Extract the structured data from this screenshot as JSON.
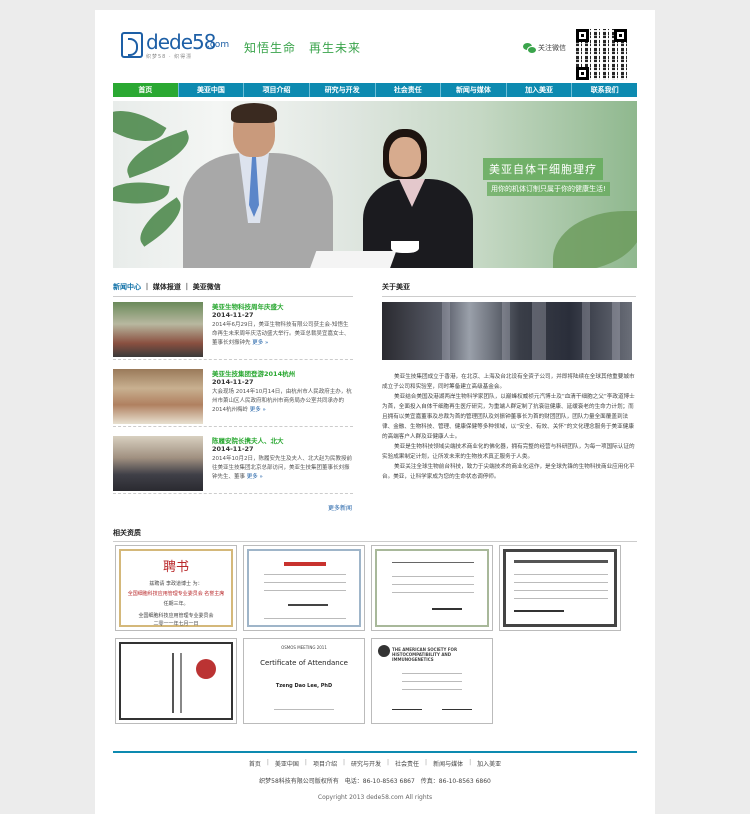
{
  "header": {
    "logo_text": "dede58",
    "logo_domain": ".com",
    "logo_sub": "织梦58 · 织得漂",
    "slogan": "知悟生命　再生未来",
    "wechat_label": "关注微信"
  },
  "nav": {
    "items": [
      "首页",
      "美亚中国",
      "项目介绍",
      "研究与开发",
      "社会责任",
      "新闻与媒体",
      "加入美亚",
      "联系我们"
    ]
  },
  "banner": {
    "title": "美亚自体干细胞理疗",
    "subtitle": "用你的机体订制只属于你的健康生活!"
  },
  "news": {
    "tabs": [
      "新闻中心",
      "媒体报道",
      "美亚微信"
    ],
    "items": [
      {
        "title": "美亚生物科技周年庆盛大",
        "date": "2014-11-27",
        "text": "2014年6月29日，美亚生物科技有限公司获主会-知悟生命再生未来周年庆活动盛大举行。美亚总裁吴宜嘉女士、董事长刘振钟先"
      },
      {
        "title": "美亚生技集团登游2014杭州",
        "date": "2014-11-27",
        "text": "大会现场 2014年10月14日，由杭州市人民政府主办，杭州市萧山区人民政府和杭州市商务局办公室共同承办的2014杭州梅岭"
      },
      {
        "title": "陈履安院长携夫人、北大",
        "date": "2014-11-27",
        "text": "2014年10月2日，陈履安先生及夫人、北大赵为民教授前往美亚生技集团北京总部访问，美亚生技集团董事长刘振钟先生、董事"
      }
    ],
    "more_inline": "更多 »",
    "more_news": "更多新闻"
  },
  "about": {
    "heading": "关于美亚",
    "paragraphs": [
      "美亚生技集团成立于香港，在北京、上海及台北设有全资子公司，并即将陆续在全球其他重要城市成立子公司和实验室，同时筹备建立高级基金会。",
      "美亚结合美国及港湖两岸生物科学家团队，以巅峰权威祯元汽博士及“血清干细胞之父”李政道博士为首，全面投入自体干细胞再生医疗研究，为重端人群定制了抗衰驻健康、延缓衰老的生命力计划；而且拥有以美宜嘉董事及总裁为首的管理团队及刘振钟董事长为首的财团团队，团队力量全面覆盖到法律、金融、生物科技、管理、健康保健等多种领域，以“安全、有效、关怀”的文化理念服务于美亚健康的高端客户人群及亚健康人士。",
      "美亚是生物科技领域尖端技术商业化的佛化器，拥有完整的经营与科研团队，为每一项国际认证的实验成果制定计划，让所发未来的生物技术真正服务于人类。",
      "美亚关注全球生物前台科技，致力于尖端技术的商业化运作，是全球先锋的生物科技商业应用化平台。美亚，让科学家成为您的生命状态调停师。"
    ]
  },
  "certificates": {
    "heading": "相关资质",
    "cert1_title": "聘书",
    "cert1_line": "兹聘请 李政道博士 为：",
    "cert1_line2": "全国细胞科技应用管理专业委员会 名誉主席",
    "cert1_line3": "任期三年。",
    "cert1_org": "全国细胞科技应用管理专业委员会",
    "cert1_date": "二零一一年七月一日",
    "cert6_title": "Certificate of Attendance",
    "cert6_header": "OSMOS MEETING 2011",
    "cert6_name": "Tzeng Dao Lee, PhD",
    "cert7_header": "THE AMERICAN SOCIETY FOR HISTOCOMPATIBILITY AND IMMUNOGENETICS"
  },
  "footer": {
    "nav": [
      "首页",
      "美亚中国",
      "项目介绍",
      "研究与开发",
      "社会责任",
      "新闻与媒体",
      "加入美亚"
    ],
    "info": "织梦58科技有限公司版权所有　电话：86-10-8563 6867　传真：86-10-8563 6860",
    "copyright": "Copyright 2013 dede58.com All rights"
  },
  "colors": {
    "nav_blue": "#0d8ab0",
    "nav_active_green": "#2aa832",
    "slogan_green": "#3aa44b",
    "logo_blue": "#1d5fa6"
  }
}
